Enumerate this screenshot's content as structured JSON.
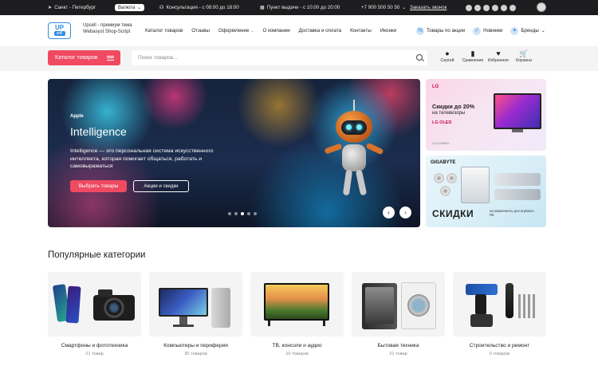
{
  "topbar": {
    "city": "Санкт - Петербург",
    "currency": "Валюта",
    "consult": "Консультация - с 08:00 до 18:00",
    "pickup": "Пункт выдачи - с 10:00 до 20:00",
    "phone": "+7 900 500 50 50",
    "callback": "Заказать звонок",
    "social_icons": [
      "vk-icon",
      "telegram-icon",
      "whatsapp-icon",
      "rutube-icon",
      "tiktok-icon",
      "plus-icon"
    ]
  },
  "header": {
    "logo_up": "UP",
    "logo_sell": "sell",
    "tagline_1": "Upsell - премиум тема",
    "tagline_2": "Webasyst Shop-Script",
    "nav": [
      "Каталог товаров",
      "Отзывы",
      "Оформление",
      "О компании",
      "Доставка и оплата",
      "Контакты",
      "Иконки"
    ],
    "links": {
      "promo": "Товары по акции",
      "new": "Новинки",
      "brands": "Бренды"
    }
  },
  "search_band": {
    "catalog_button": "Каталог товаров",
    "search_placeholder": "Поиск товаров...",
    "actions": {
      "user": "Сергей",
      "compare": "Сравнение",
      "favorites": "Избранное",
      "cart": "Корзина"
    }
  },
  "hero": {
    "kicker": "Apple",
    "title": "Intelligence",
    "description": "Intelligence — это персональная система искусственного интеллекта, которая помогает общаться, работать и самовыражаться",
    "primary_button": "Выбрать товары",
    "secondary_button": "Акции и скидки"
  },
  "side_banners": {
    "lg": {
      "brand": "LG",
      "title_1": "Скидки до 20%",
      "title_2": "на телевизоры",
      "badge": "LG OLED",
      "footnote": "LG.COM/RU"
    },
    "gigabyte": {
      "brand": "GIGABYTE",
      "big": "СКИДКИ",
      "small": "на компоненты для игрового ПК"
    }
  },
  "categories": {
    "title": "Популярные категории",
    "items": [
      {
        "name": "Смартфоны и фототехника",
        "count": "21 товар"
      },
      {
        "name": "Компьютеры и периферия",
        "count": "30 товаров"
      },
      {
        "name": "ТВ, консоли и аудио",
        "count": "10 товаров"
      },
      {
        "name": "Бытовая техника",
        "count": "21 товар"
      },
      {
        "name": "Строительство и ремонт",
        "count": "0 товаров"
      }
    ]
  },
  "colors": {
    "accent": "#ef4a62",
    "brand_blue": "#2f8de4",
    "topbar_bg": "#1d1d1f"
  }
}
